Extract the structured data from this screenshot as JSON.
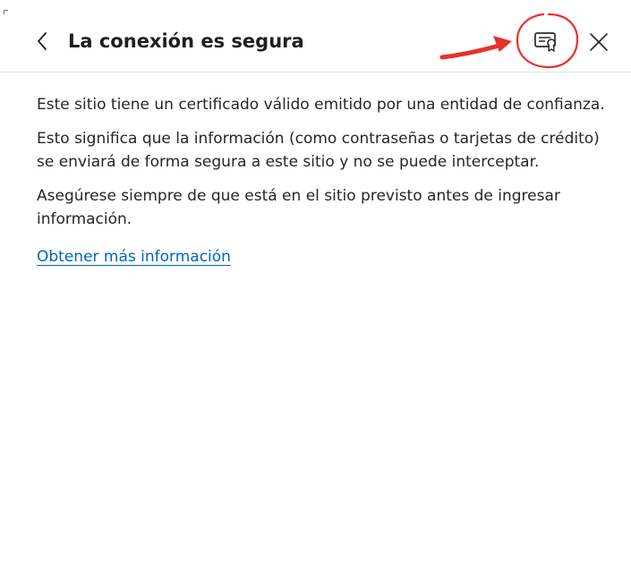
{
  "header": {
    "title": "La conexión es segura",
    "icons": {
      "back": "chevron-left-icon",
      "certificate": "certificate-icon",
      "close": "close-icon"
    }
  },
  "content": {
    "paragraphs": [
      "Este sitio tiene un certificado válido emitido por una entidad de confianza.",
      "Esto significa que la información (como contraseñas o tarjetas de crédito) se enviará de forma segura a este sitio y no se puede interceptar.",
      "Asegúrese siempre de que está en el sitio previsto antes de ingresar información."
    ],
    "link_label": "Obtener más información"
  },
  "annotation": {
    "color": "#e8302c",
    "shapes": [
      "circle",
      "arrow"
    ]
  },
  "colors": {
    "link": "#0066b8",
    "text": "#262626",
    "divider": "#e1e1e1"
  }
}
